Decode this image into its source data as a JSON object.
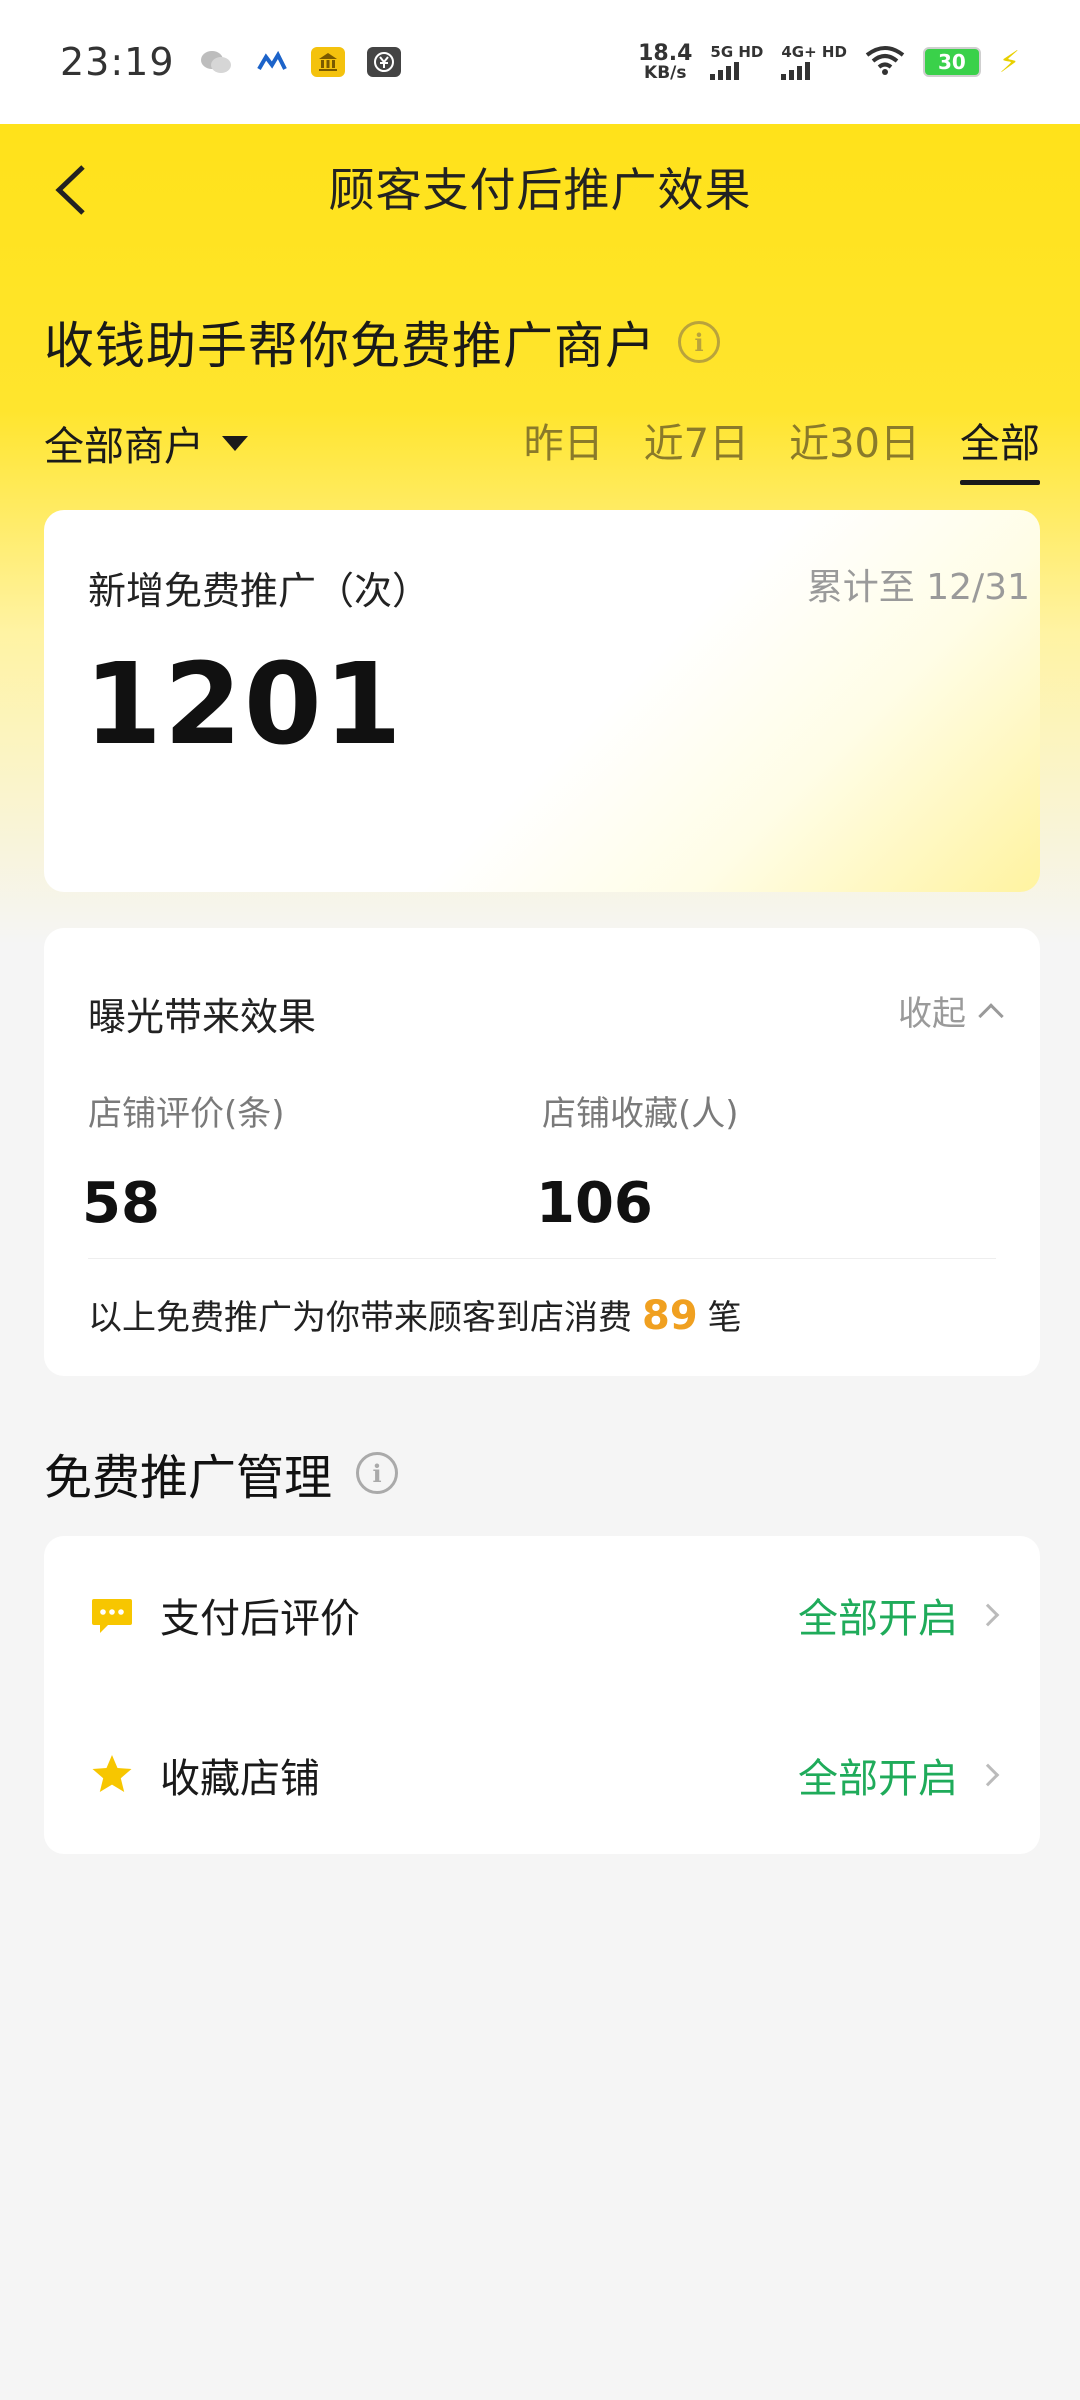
{
  "status_bar": {
    "time": "23:19",
    "net_speed_value": "18.4",
    "net_speed_unit": "KB/s",
    "sim1": "5G HD",
    "sim2": "4G+ HD",
    "battery": "30",
    "left_icons": [
      "wechat-icon",
      "map-icon",
      "bank-app-icon",
      "wallet-app-icon"
    ]
  },
  "nav": {
    "title": "顾客支付后推广效果"
  },
  "promo": {
    "headline": "收钱助手帮你免费推广商户",
    "info_glyph": "i"
  },
  "filter": {
    "merchant": "全部商户",
    "tabs": [
      "昨日",
      "近7日",
      "近30日",
      "全部"
    ],
    "active_tab": "全部"
  },
  "count_card": {
    "label": "新增免费推广（次）",
    "cumulative": "累计至 12/31",
    "value": "1201"
  },
  "effect_card": {
    "title": "曝光带来效果",
    "collapse_label": "收起",
    "stats": [
      {
        "label": "店铺评价(条)",
        "value": "58"
      },
      {
        "label": "店铺收藏(人)",
        "value": "106"
      }
    ],
    "footnote_prefix": "以上免费推广为你带来顾客到店消费",
    "footnote_count": "89",
    "footnote_suffix": "笔"
  },
  "management": {
    "heading": "免费推广管理",
    "rows": [
      {
        "label": "支付后评价",
        "status": "全部开启",
        "icon": "comment-icon"
      },
      {
        "label": "收藏店铺",
        "status": "全部开启",
        "icon": "star-icon"
      }
    ]
  },
  "colors": {
    "brand_yellow": "#ffe21a",
    "status_green": "#1fab5a",
    "highlight_orange": "#f0a020"
  }
}
